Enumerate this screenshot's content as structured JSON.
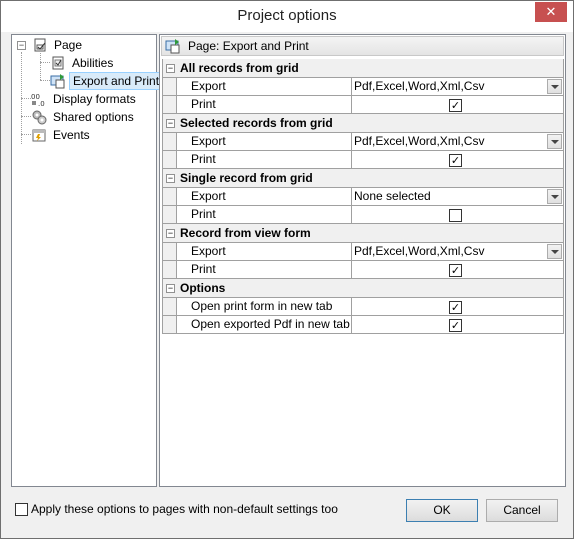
{
  "window": {
    "title": "Project options",
    "close_glyph": "✕"
  },
  "tree": {
    "items": [
      {
        "label": "Page",
        "icon": "page-icon",
        "expander": "−"
      },
      {
        "label": "Abilities",
        "icon": "abilities-icon"
      },
      {
        "label": "Export and Print",
        "icon": "export-print-icon",
        "selected": true
      },
      {
        "label": "Display formats",
        "icon": "display-formats-icon"
      },
      {
        "label": "Shared options",
        "icon": "shared-options-icon"
      },
      {
        "label": "Events",
        "icon": "events-icon"
      }
    ]
  },
  "page_header": {
    "label": "Page: Export and Print",
    "icon": "export-print-icon"
  },
  "grid": {
    "sections": [
      {
        "title": "All records from grid",
        "rows": [
          {
            "name": "Export",
            "type": "combo",
            "value": "Pdf,Excel,Word,Xml,Csv"
          },
          {
            "name": "Print",
            "type": "check",
            "checked": "✓"
          }
        ]
      },
      {
        "title": "Selected records from grid",
        "rows": [
          {
            "name": "Export",
            "type": "combo",
            "value": "Pdf,Excel,Word,Xml,Csv"
          },
          {
            "name": "Print",
            "type": "check",
            "checked": "✓"
          }
        ]
      },
      {
        "title": "Single record from grid",
        "rows": [
          {
            "name": "Export",
            "type": "combo",
            "value": "None selected"
          },
          {
            "name": "Print",
            "type": "check",
            "checked": ""
          }
        ]
      },
      {
        "title": "Record from view form",
        "rows": [
          {
            "name": "Export",
            "type": "combo",
            "value": "Pdf,Excel,Word,Xml,Csv"
          },
          {
            "name": "Print",
            "type": "check",
            "checked": "✓"
          }
        ]
      },
      {
        "title": "Options",
        "rows": [
          {
            "name": "Open print form in new tab",
            "type": "check",
            "checked": "✓"
          },
          {
            "name": "Open exported Pdf in new tab",
            "type": "check",
            "checked": "✓"
          }
        ]
      }
    ]
  },
  "footer": {
    "apply_label": "Apply these options to pages with non-default settings too",
    "ok_label": "OK",
    "cancel_label": "Cancel"
  }
}
